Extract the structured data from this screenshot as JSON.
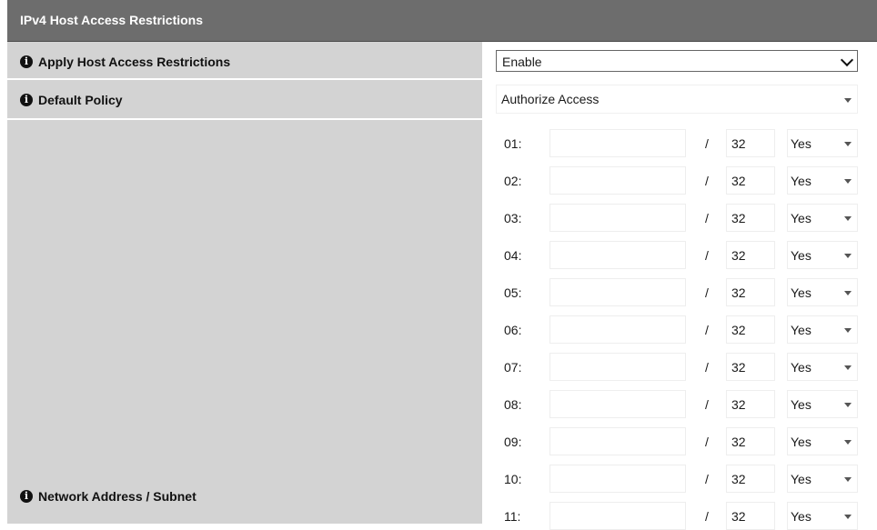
{
  "section": {
    "title": "IPv4 Host Access Restrictions"
  },
  "apply": {
    "label": "Apply Host Access Restrictions",
    "value": "Enable"
  },
  "policy": {
    "label": "Default Policy",
    "value": "Authorize Access"
  },
  "network": {
    "label": "Network Address / Subnet",
    "separator": "/",
    "rows": [
      {
        "num": "01:",
        "address": "",
        "mask": "32",
        "enabled": "Yes"
      },
      {
        "num": "02:",
        "address": "",
        "mask": "32",
        "enabled": "Yes"
      },
      {
        "num": "03:",
        "address": "",
        "mask": "32",
        "enabled": "Yes"
      },
      {
        "num": "04:",
        "address": "",
        "mask": "32",
        "enabled": "Yes"
      },
      {
        "num": "05:",
        "address": "",
        "mask": "32",
        "enabled": "Yes"
      },
      {
        "num": "06:",
        "address": "",
        "mask": "32",
        "enabled": "Yes"
      },
      {
        "num": "07:",
        "address": "",
        "mask": "32",
        "enabled": "Yes"
      },
      {
        "num": "08:",
        "address": "",
        "mask": "32",
        "enabled": "Yes"
      },
      {
        "num": "09:",
        "address": "",
        "mask": "32",
        "enabled": "Yes"
      },
      {
        "num": "10:",
        "address": "",
        "mask": "32",
        "enabled": "Yes"
      },
      {
        "num": "11:",
        "address": "",
        "mask": "32",
        "enabled": "Yes"
      }
    ]
  },
  "icons": {
    "info": "info-icon",
    "dropdown": "chevron-down-icon"
  }
}
